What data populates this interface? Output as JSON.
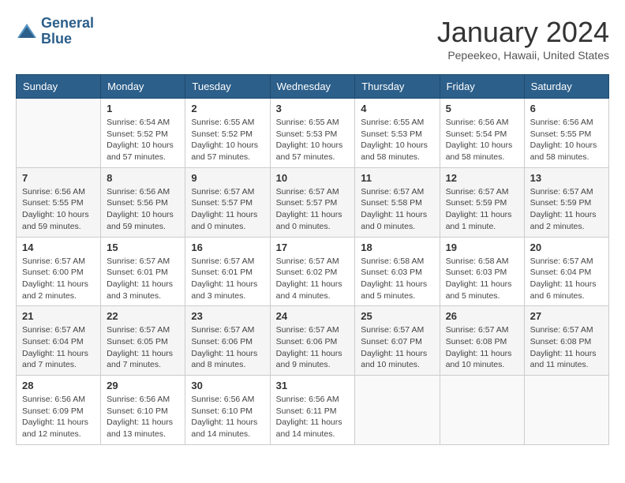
{
  "logo": {
    "line1": "General",
    "line2": "Blue"
  },
  "title": "January 2024",
  "subtitle": "Pepeekeo, Hawaii, United States",
  "days": [
    "Sunday",
    "Monday",
    "Tuesday",
    "Wednesday",
    "Thursday",
    "Friday",
    "Saturday"
  ],
  "weeks": [
    [
      {
        "date": "",
        "sunrise": "",
        "sunset": "",
        "daylight": ""
      },
      {
        "date": "1",
        "sunrise": "Sunrise: 6:54 AM",
        "sunset": "Sunset: 5:52 PM",
        "daylight": "Daylight: 10 hours and 57 minutes."
      },
      {
        "date": "2",
        "sunrise": "Sunrise: 6:55 AM",
        "sunset": "Sunset: 5:52 PM",
        "daylight": "Daylight: 10 hours and 57 minutes."
      },
      {
        "date": "3",
        "sunrise": "Sunrise: 6:55 AM",
        "sunset": "Sunset: 5:53 PM",
        "daylight": "Daylight: 10 hours and 57 minutes."
      },
      {
        "date": "4",
        "sunrise": "Sunrise: 6:55 AM",
        "sunset": "Sunset: 5:53 PM",
        "daylight": "Daylight: 10 hours and 58 minutes."
      },
      {
        "date": "5",
        "sunrise": "Sunrise: 6:56 AM",
        "sunset": "Sunset: 5:54 PM",
        "daylight": "Daylight: 10 hours and 58 minutes."
      },
      {
        "date": "6",
        "sunrise": "Sunrise: 6:56 AM",
        "sunset": "Sunset: 5:55 PM",
        "daylight": "Daylight: 10 hours and 58 minutes."
      }
    ],
    [
      {
        "date": "7",
        "sunrise": "Sunrise: 6:56 AM",
        "sunset": "Sunset: 5:55 PM",
        "daylight": "Daylight: 10 hours and 59 minutes."
      },
      {
        "date": "8",
        "sunrise": "Sunrise: 6:56 AM",
        "sunset": "Sunset: 5:56 PM",
        "daylight": "Daylight: 10 hours and 59 minutes."
      },
      {
        "date": "9",
        "sunrise": "Sunrise: 6:57 AM",
        "sunset": "Sunset: 5:57 PM",
        "daylight": "Daylight: 11 hours and 0 minutes."
      },
      {
        "date": "10",
        "sunrise": "Sunrise: 6:57 AM",
        "sunset": "Sunset: 5:57 PM",
        "daylight": "Daylight: 11 hours and 0 minutes."
      },
      {
        "date": "11",
        "sunrise": "Sunrise: 6:57 AM",
        "sunset": "Sunset: 5:58 PM",
        "daylight": "Daylight: 11 hours and 0 minutes."
      },
      {
        "date": "12",
        "sunrise": "Sunrise: 6:57 AM",
        "sunset": "Sunset: 5:59 PM",
        "daylight": "Daylight: 11 hours and 1 minute."
      },
      {
        "date": "13",
        "sunrise": "Sunrise: 6:57 AM",
        "sunset": "Sunset: 5:59 PM",
        "daylight": "Daylight: 11 hours and 2 minutes."
      }
    ],
    [
      {
        "date": "14",
        "sunrise": "Sunrise: 6:57 AM",
        "sunset": "Sunset: 6:00 PM",
        "daylight": "Daylight: 11 hours and 2 minutes."
      },
      {
        "date": "15",
        "sunrise": "Sunrise: 6:57 AM",
        "sunset": "Sunset: 6:01 PM",
        "daylight": "Daylight: 11 hours and 3 minutes."
      },
      {
        "date": "16",
        "sunrise": "Sunrise: 6:57 AM",
        "sunset": "Sunset: 6:01 PM",
        "daylight": "Daylight: 11 hours and 3 minutes."
      },
      {
        "date": "17",
        "sunrise": "Sunrise: 6:57 AM",
        "sunset": "Sunset: 6:02 PM",
        "daylight": "Daylight: 11 hours and 4 minutes."
      },
      {
        "date": "18",
        "sunrise": "Sunrise: 6:58 AM",
        "sunset": "Sunset: 6:03 PM",
        "daylight": "Daylight: 11 hours and 5 minutes."
      },
      {
        "date": "19",
        "sunrise": "Sunrise: 6:58 AM",
        "sunset": "Sunset: 6:03 PM",
        "daylight": "Daylight: 11 hours and 5 minutes."
      },
      {
        "date": "20",
        "sunrise": "Sunrise: 6:57 AM",
        "sunset": "Sunset: 6:04 PM",
        "daylight": "Daylight: 11 hours and 6 minutes."
      }
    ],
    [
      {
        "date": "21",
        "sunrise": "Sunrise: 6:57 AM",
        "sunset": "Sunset: 6:04 PM",
        "daylight": "Daylight: 11 hours and 7 minutes."
      },
      {
        "date": "22",
        "sunrise": "Sunrise: 6:57 AM",
        "sunset": "Sunset: 6:05 PM",
        "daylight": "Daylight: 11 hours and 7 minutes."
      },
      {
        "date": "23",
        "sunrise": "Sunrise: 6:57 AM",
        "sunset": "Sunset: 6:06 PM",
        "daylight": "Daylight: 11 hours and 8 minutes."
      },
      {
        "date": "24",
        "sunrise": "Sunrise: 6:57 AM",
        "sunset": "Sunset: 6:06 PM",
        "daylight": "Daylight: 11 hours and 9 minutes."
      },
      {
        "date": "25",
        "sunrise": "Sunrise: 6:57 AM",
        "sunset": "Sunset: 6:07 PM",
        "daylight": "Daylight: 11 hours and 10 minutes."
      },
      {
        "date": "26",
        "sunrise": "Sunrise: 6:57 AM",
        "sunset": "Sunset: 6:08 PM",
        "daylight": "Daylight: 11 hours and 10 minutes."
      },
      {
        "date": "27",
        "sunrise": "Sunrise: 6:57 AM",
        "sunset": "Sunset: 6:08 PM",
        "daylight": "Daylight: 11 hours and 11 minutes."
      }
    ],
    [
      {
        "date": "28",
        "sunrise": "Sunrise: 6:56 AM",
        "sunset": "Sunset: 6:09 PM",
        "daylight": "Daylight: 11 hours and 12 minutes."
      },
      {
        "date": "29",
        "sunrise": "Sunrise: 6:56 AM",
        "sunset": "Sunset: 6:10 PM",
        "daylight": "Daylight: 11 hours and 13 minutes."
      },
      {
        "date": "30",
        "sunrise": "Sunrise: 6:56 AM",
        "sunset": "Sunset: 6:10 PM",
        "daylight": "Daylight: 11 hours and 14 minutes."
      },
      {
        "date": "31",
        "sunrise": "Sunrise: 6:56 AM",
        "sunset": "Sunset: 6:11 PM",
        "daylight": "Daylight: 11 hours and 14 minutes."
      },
      {
        "date": "",
        "sunrise": "",
        "sunset": "",
        "daylight": ""
      },
      {
        "date": "",
        "sunrise": "",
        "sunset": "",
        "daylight": ""
      },
      {
        "date": "",
        "sunrise": "",
        "sunset": "",
        "daylight": ""
      }
    ]
  ]
}
